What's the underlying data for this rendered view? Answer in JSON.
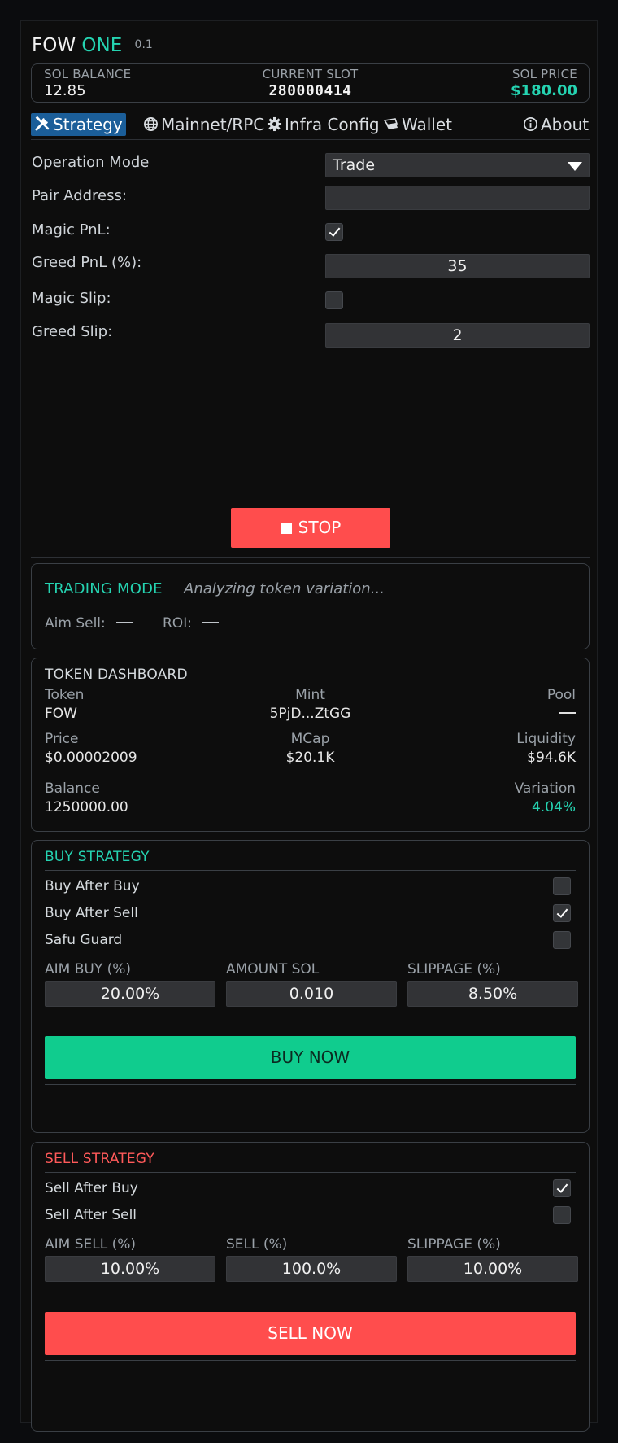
{
  "app": {
    "name": "FOW",
    "name_accent": "ONE",
    "version": "0.1"
  },
  "stats": {
    "sol_balance_label": "SOL BALANCE",
    "sol_balance": "12.85",
    "current_slot_label": "CURRENT SLOT",
    "current_slot": "280000414",
    "sol_price_label": "SOL PRICE",
    "sol_price": "$180.00"
  },
  "tabs": [
    {
      "label": "Strategy",
      "icon": "tools-icon",
      "active": true
    },
    {
      "label": "Mainnet/RPC",
      "icon": "globe-icon"
    },
    {
      "label": "Infra Config",
      "icon": "gear-icon"
    },
    {
      "label": "Wallet",
      "icon": "wallet-icon"
    },
    {
      "label": "About",
      "icon": "info-icon"
    }
  ],
  "form": {
    "operation_mode_label": "Operation Mode",
    "operation_mode_value": "Trade",
    "pair_address_label": "Pair Address:",
    "pair_address_value": "",
    "magic_pnl_label": "Magic PnL:",
    "magic_pnl_checked": true,
    "greed_pnl_label": "Greed PnL (%):",
    "greed_pnl_value": "35",
    "magic_slip_label": "Magic Slip:",
    "magic_slip_checked": false,
    "greed_slip_label": "Greed Slip:",
    "greed_slip_value": "2"
  },
  "stop_button": "STOP",
  "trading": {
    "title": "TRADING MODE",
    "status": "Analyzing token variation...",
    "aim_sell_label": "Aim Sell:",
    "roi_label": "ROI:"
  },
  "dashboard": {
    "title": "TOKEN DASHBOARD",
    "token_label": "Token",
    "token_value": "FOW",
    "mint_label": "Mint",
    "mint_value": "5PjD...ZtGG",
    "pool_label": "Pool",
    "price_label": "Price",
    "price_value": "$0.00002009",
    "mcap_label": "MCap",
    "mcap_value": "$20.1K",
    "liquidity_label": "Liquidity",
    "liquidity_value": "$94.6K",
    "balance_label": "Balance",
    "balance_value": "1250000.00",
    "variation_label": "Variation",
    "variation_value": "4.04%"
  },
  "buy": {
    "title": "BUY STRATEGY",
    "options": [
      {
        "label": "Buy After Buy",
        "checked": false
      },
      {
        "label": "Buy After Sell",
        "checked": true
      },
      {
        "label": "Safu Guard",
        "checked": false
      }
    ],
    "aim_label": "AIM BUY (%)",
    "aim_value": "20.00%",
    "amount_label": "AMOUNT SOL",
    "amount_value": "0.010",
    "slippage_label": "SLIPPAGE (%)",
    "slippage_value": "8.50%",
    "button": "BUY NOW"
  },
  "sell": {
    "title": "SELL STRATEGY",
    "options": [
      {
        "label": "Sell After Buy",
        "checked": true
      },
      {
        "label": "Sell After Sell",
        "checked": false
      }
    ],
    "aim_label": "AIM SELL (%)",
    "aim_value": "10.00%",
    "sell_label": "SELL (%)",
    "sell_value": "100.0%",
    "slippage_label": "SLIPPAGE (%)",
    "slippage_value": "10.00%",
    "button": "SELL NOW"
  },
  "colors": {
    "accent": "#25d3b1",
    "danger": "#ff4d4d",
    "tab_active": "#1b5e99",
    "buy": "#10cc8e"
  }
}
